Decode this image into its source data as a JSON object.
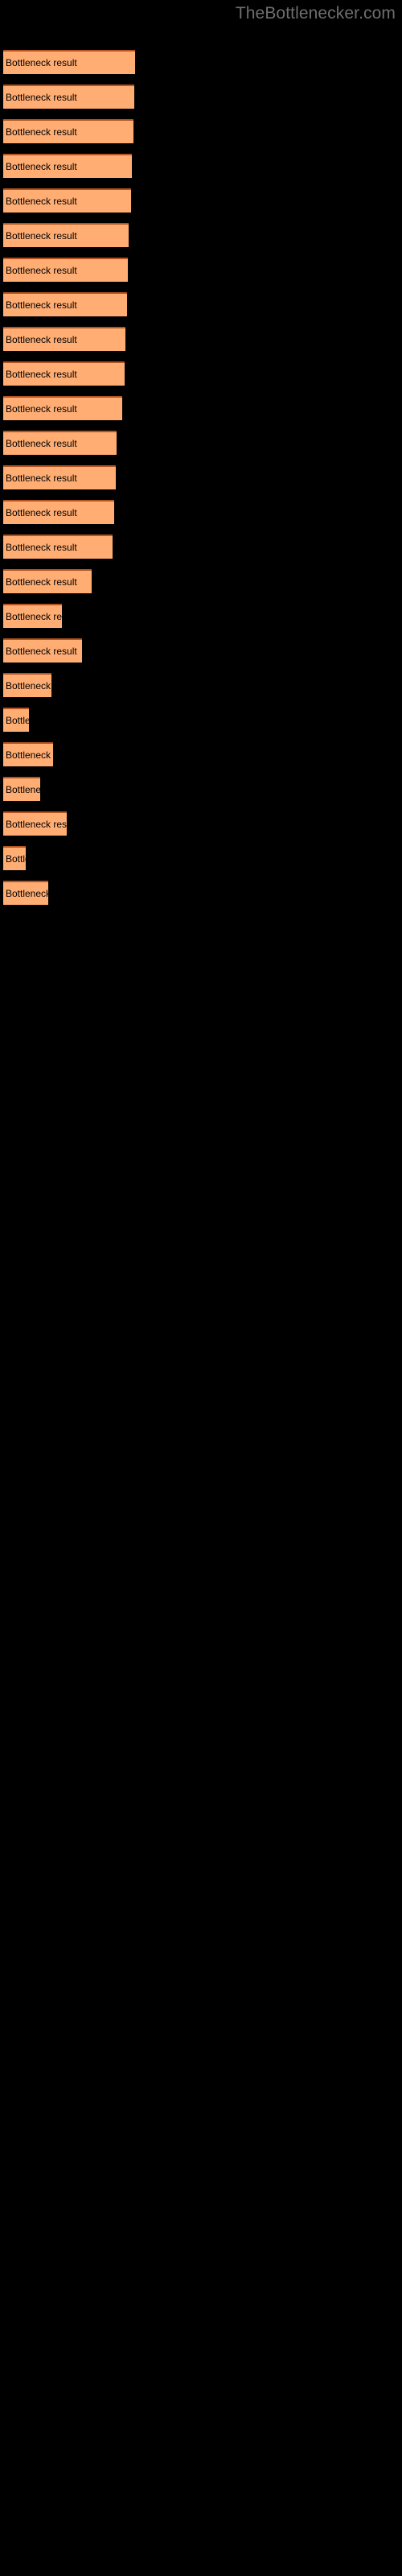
{
  "watermark": "TheBottlenecker.com",
  "colors": {
    "background": "#000000",
    "bar_fill": "#ffad73",
    "bar_edge": "#b5541e",
    "label_text": "#000000",
    "watermark_text": "#6e6e6e"
  },
  "chart_data": {
    "type": "bar",
    "orientation": "horizontal",
    "title": "",
    "subtitle": "",
    "xlabel": "",
    "ylabel": "",
    "grid": false,
    "legend": null,
    "axis_visible": false,
    "tick_labels": [],
    "bar_label_text": "Bottleneck result",
    "xlim": [
      0,
      172
    ],
    "categories": [
      "Bottleneck result",
      "Bottleneck result",
      "Bottleneck result",
      "Bottleneck result",
      "Bottleneck result",
      "Bottleneck result",
      "Bottleneck result",
      "Bottleneck result",
      "Bottleneck result",
      "Bottleneck result",
      "Bottleneck result",
      "Bottleneck result",
      "Bottleneck result",
      "Bottleneck result",
      "Bottleneck result",
      "Bottleneck result",
      "Bottleneck result",
      "Bottleneck result",
      "Bottleneck result",
      "Bottleneck result",
      "Bottleneck result",
      "Bottleneck result",
      "Bottleneck result",
      "Bottleneck result"
    ],
    "values": [
      164,
      163,
      162,
      160,
      159,
      156,
      155,
      154,
      152,
      151,
      148,
      141,
      140,
      138,
      136,
      110,
      73,
      98,
      60,
      32,
      62,
      46,
      79,
      28,
      56
    ]
  },
  "bars": [
    {
      "label": "Bottleneck result",
      "y": 62,
      "width": 164
    },
    {
      "label": "Bottleneck result",
      "y": 105,
      "width": 163
    },
    {
      "label": "Bottleneck result",
      "y": 148,
      "width": 162
    },
    {
      "label": "Bottleneck result",
      "y": 191,
      "width": 160
    },
    {
      "label": "Bottleneck result",
      "y": 234,
      "width": 159
    },
    {
      "label": "Bottleneck result",
      "y": 277,
      "width": 156
    },
    {
      "label": "Bottleneck result",
      "y": 320,
      "width": 155
    },
    {
      "label": "Bottleneck result",
      "y": 363,
      "width": 154
    },
    {
      "label": "Bottleneck result",
      "y": 406,
      "width": 152
    },
    {
      "label": "Bottleneck result",
      "y": 449,
      "width": 151
    },
    {
      "label": "Bottleneck result",
      "y": 492,
      "width": 148
    },
    {
      "label": "Bottleneck result",
      "y": 535,
      "width": 141
    },
    {
      "label": "Bottleneck result",
      "y": 578,
      "width": 140
    },
    {
      "label": "Bottleneck result",
      "y": 621,
      "width": 138
    },
    {
      "label": "Bottleneck result",
      "y": 664,
      "width": 136
    },
    {
      "label": "Bottleneck result",
      "y": 707,
      "width": 110
    },
    {
      "label": "Bottleneck result",
      "y": 750,
      "width": 73
    },
    {
      "label": "Bottleneck result",
      "y": 793,
      "width": 98
    },
    {
      "label": "Bottleneck result",
      "y": 836,
      "width": 60
    },
    {
      "label": "Bottleneck result",
      "y": 879,
      "width": 32
    },
    {
      "label": "Bottleneck result",
      "y": 922,
      "width": 62
    },
    {
      "label": "Bottleneck result",
      "y": 965,
      "width": 46
    },
    {
      "label": "Bottleneck result",
      "y": 1008,
      "width": 79
    },
    {
      "label": "Bottleneck result",
      "y": 1051,
      "width": 28
    },
    {
      "label": "Bottleneck result",
      "y": 1094,
      "width": 56
    }
  ]
}
